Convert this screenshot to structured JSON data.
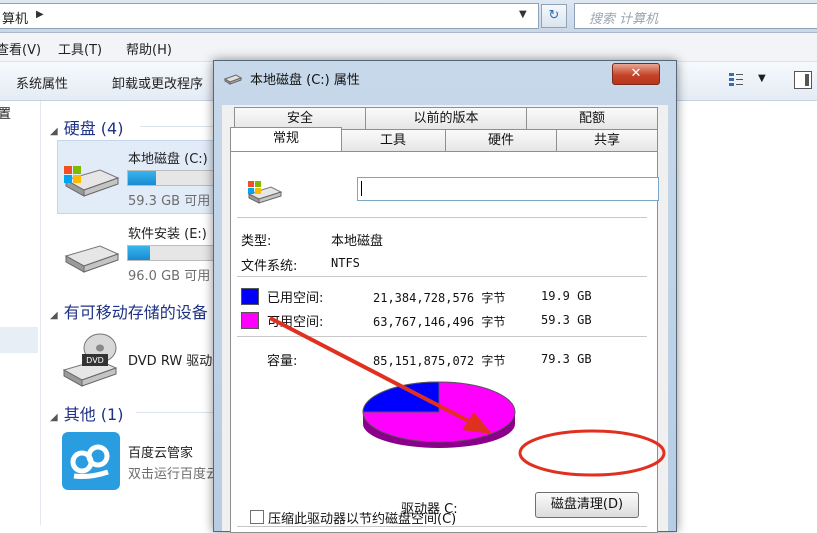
{
  "explorer": {
    "address": "算机",
    "search_placeholder": "搜索 计算机",
    "menu": [
      "查看(V)",
      "工具(T)",
      "帮助(H)"
    ],
    "commands": [
      "系统属性",
      "卸载或更改程序"
    ],
    "nav_item": "置",
    "groups": {
      "hard_disks": "硬盘 (4)",
      "removable": "有可移动存储的设备",
      "other": "其他 (1)"
    },
    "drives": [
      {
        "name": "本地磁盘 (C:)",
        "size": "59.3 GB 可用",
        "used_fraction": 0.25
      },
      {
        "name": "软件安装 (E:)",
        "size": "96.0 GB 可用",
        "used_fraction": 0.2
      }
    ],
    "dvd": "DVD RW 驱动器",
    "app": {
      "name": "百度云管家",
      "sub": "双击运行百度云管家"
    }
  },
  "dialog": {
    "title": "本地磁盘 (C:) 属性",
    "close_label": "✕",
    "tabs_row1": [
      "安全",
      "以前的版本",
      "配额"
    ],
    "tabs_row2": [
      "常规",
      "工具",
      "硬件",
      "共享"
    ],
    "name_value": "",
    "type_label": "类型:",
    "type_value": "本地磁盘",
    "fs_label": "文件系统:",
    "fs_value": "NTFS",
    "used_label": "已用空间:",
    "used_bytes": "21,384,728,576 字节",
    "used_gb": "19.9 GB",
    "free_label": "可用空间:",
    "free_bytes": "63,767,146,496 字节",
    "free_gb": "59.3 GB",
    "capacity_label": "容量:",
    "capacity_bytes": "85,151,875,072 字节",
    "capacity_gb": "79.3 GB",
    "drive_label": "驱动器 C:",
    "cleanup_label": "磁盘清理(D)",
    "compress_label": "压缩此驱动器以节约磁盘空间(C)",
    "colors": {
      "used": "#0000ff",
      "free": "#ff00ff",
      "annotation": "#e03020"
    }
  }
}
